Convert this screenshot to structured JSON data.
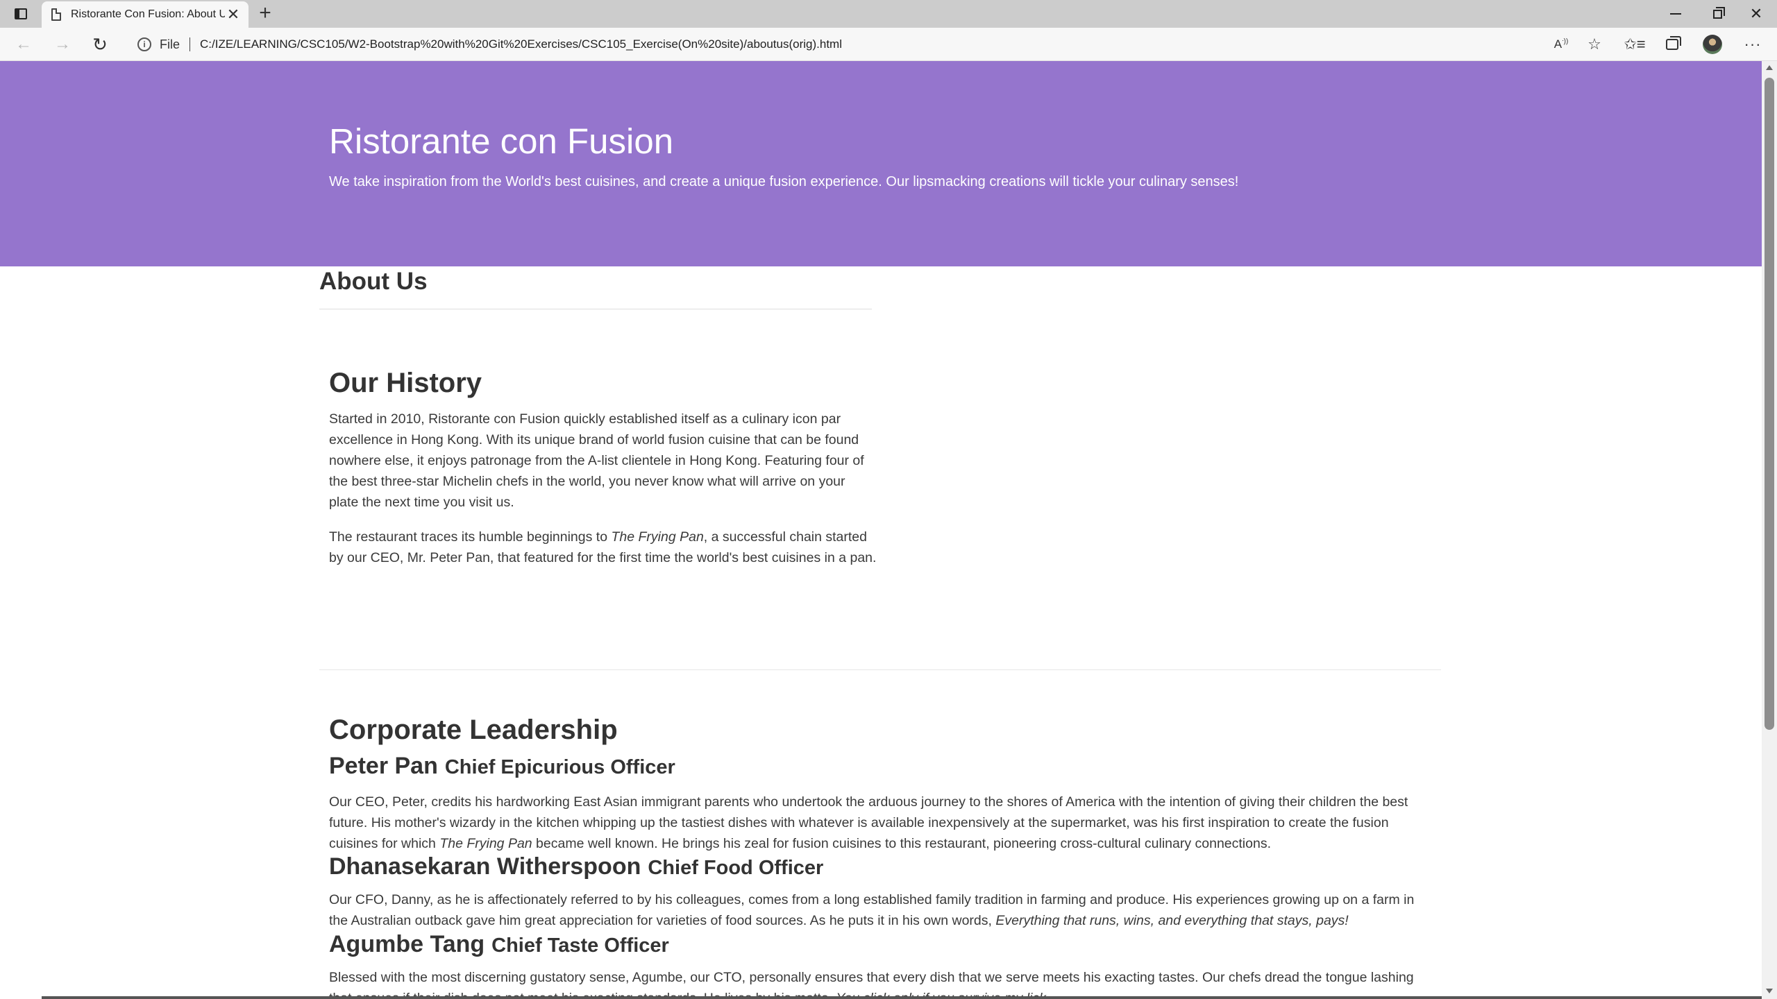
{
  "browser": {
    "tab_title": "Ristorante Con Fusion: About Us",
    "tab_close": "✕",
    "new_tab": "+",
    "scheme_label": "File",
    "url": "C:/IZE/LEARNING/CSC105/W2-Bootstrap%20with%20Git%20Exercises/CSC105_Exercise(On%20site)/aboutus(orig).html",
    "icons": {
      "back": "arrow-left-icon",
      "forward": "arrow-right-icon",
      "reload": "reload-icon",
      "info": "info-icon",
      "read_aloud": "read-aloud-icon",
      "add_favorite": "star-plus-icon",
      "favorites": "favorites-list-icon",
      "collections": "collections-icon",
      "more": "more-dots-icon"
    }
  },
  "jumbotron": {
    "title": "Ristorante con Fusion",
    "subtitle": "We take inspiration from the World's best cuisines, and create a unique fusion experience. Our lipsmacking creations will tickle your culinary senses!",
    "background": "#9575cd"
  },
  "page": {
    "heading": "About Us"
  },
  "history": {
    "title": "Our History",
    "p1": "Started in 2010, Ristorante con Fusion quickly established itself as a culinary icon par excellence in Hong Kong. With its unique brand of world fusion cuisine that can be found nowhere else, it enjoys patronage from the A-list clientele in Hong Kong. Featuring four of the best three-star Michelin chefs in the world, you never know what will arrive on your plate the next time you visit us.",
    "p2_before": "The restaurant traces its humble beginnings to ",
    "p2_em": "The Frying Pan",
    "p2_after": ", a successful chain started by our CEO, Mr. Peter Pan, that featured for the first time the world's best cuisines in a pan."
  },
  "leadership": {
    "title": "Corporate Leadership",
    "leaders": [
      {
        "name": "Peter Pan",
        "role": "Chief Epicurious Officer",
        "desc_before": "Our CEO, Peter, credits his hardworking East Asian immigrant parents who undertook the arduous journey to the shores of America with the intention of giving their children the best future. His mother's wizardy in the kitchen whipping up the tastiest dishes with whatever is available inexpensively at the supermarket, was his first inspiration to create the fusion cuisines for which ",
        "desc_em": "The Frying Pan",
        "desc_after": " became well known. He brings his zeal for fusion cuisines to this restaurant, pioneering cross-cultural culinary connections."
      },
      {
        "name": "Dhanasekaran Witherspoon",
        "role": "Chief Food Officer",
        "desc_before": "Our CFO, Danny, as he is affectionately referred to by his colleagues, comes from a long established family tradition in farming and produce. His experiences growing up on a farm in the Australian outback gave him great appreciation for varieties of food sources. As he puts it in his own words, ",
        "desc_em": "Everything that runs, wins, and everything that stays, pays!",
        "desc_after": ""
      },
      {
        "name": "Agumbe Tang",
        "role": "Chief Taste Officer",
        "desc_before": "Blessed with the most discerning gustatory sense, Agumbe, our CTO, personally ensures that every dish that we serve meets his exacting tastes. Our chefs dread the tongue lashing that ensues if their dish does not meet his exacting standards. He lives by his motto, ",
        "desc_em": "You click only if you survive my lick.",
        "desc_after": ""
      }
    ]
  }
}
